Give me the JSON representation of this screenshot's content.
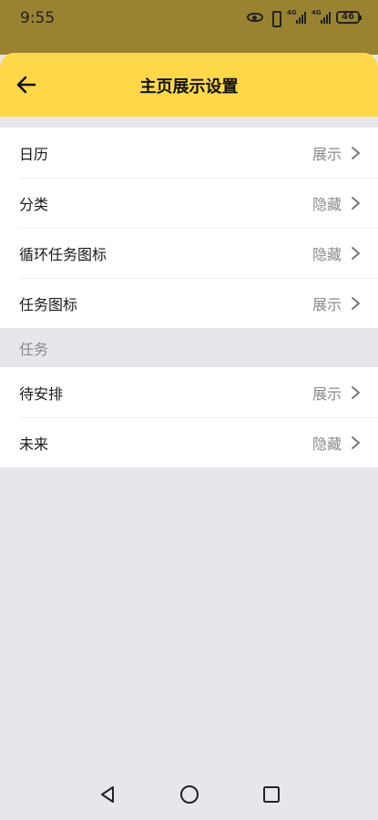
{
  "status": {
    "time": "9:55",
    "battery": "46",
    "network_label": "4G"
  },
  "header": {
    "title": "主页展示设置"
  },
  "general": {
    "items": [
      {
        "label": "日历",
        "value": "展示"
      },
      {
        "label": "分类",
        "value": "隐藏"
      },
      {
        "label": "循环任务图标",
        "value": "隐藏"
      },
      {
        "label": "任务图标",
        "value": "展示"
      }
    ]
  },
  "tasks": {
    "section_title": "任务",
    "items": [
      {
        "label": "待安排",
        "value": "展示"
      },
      {
        "label": "未来",
        "value": "隐藏"
      }
    ]
  },
  "colors": {
    "header_bg": "#fed848",
    "status_bg": "#9a8330",
    "page_bg": "#e6e7eb"
  }
}
